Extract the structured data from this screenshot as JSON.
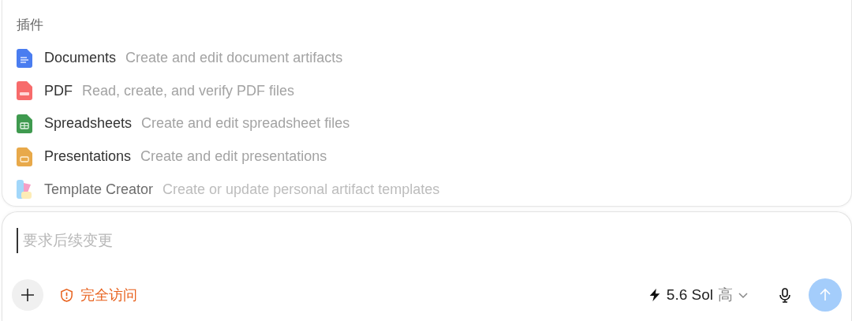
{
  "plugins": {
    "heading": "插件",
    "items": [
      {
        "kind": "document",
        "name": "Documents",
        "description": "Create and edit document artifacts",
        "faded": false
      },
      {
        "kind": "pdf",
        "name": "PDF",
        "description": "Read, create, and verify PDF files",
        "faded": false
      },
      {
        "kind": "spreadsheet",
        "name": "Spreadsheets",
        "description": "Create and edit spreadsheet files",
        "faded": false
      },
      {
        "kind": "presentation",
        "name": "Presentations",
        "description": "Create and edit presentations",
        "faded": false
      },
      {
        "kind": "template",
        "name": "Template Creator",
        "description": "Create or update personal artifact templates",
        "faded": true
      }
    ]
  },
  "composer": {
    "placeholder": "要求后续变更",
    "access": "完全访问",
    "model": "5.6 Sol",
    "effort": "高",
    "send_disabled": true
  }
}
